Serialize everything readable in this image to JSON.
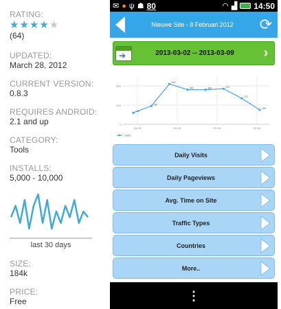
{
  "listing": {
    "rating_label": "RATING:",
    "rating_stars": 4,
    "rating_max": 5,
    "rating_count": "(64)",
    "updated_label": "UPDATED:",
    "updated_value": "March 28, 2012",
    "version_label": "CURRENT VERSION:",
    "version_value": "0.8.3",
    "requires_label": "REQUIRES ANDROID:",
    "requires_value": "2.1 and up",
    "category_label": "CATEGORY:",
    "category_value": "Tools",
    "installs_label": "INSTALLS:",
    "installs_value": "5,000 - 10,000",
    "sparkline_caption": "last 30 days",
    "sparkline_values": [
      5,
      7,
      4,
      8,
      3,
      7,
      9,
      4,
      8,
      3,
      6,
      4,
      7,
      5,
      8,
      4,
      6,
      5
    ],
    "size_label": "SIZE:",
    "size_value": "184k",
    "price_label": "PRICE:",
    "price_value": "Free",
    "colors": {
      "accent": "#3fa9d8",
      "star_off": "#c9c9c9"
    }
  },
  "statusbar": {
    "icons": [
      "mail-icon",
      "circle-icon",
      "usb-icon",
      "android-icon"
    ],
    "temperature": "80",
    "time": "14:50"
  },
  "app": {
    "title": "Nieuwe Site - 8 Februari 2012",
    "date_range": "2013-03-02 -- 2013-03-09",
    "colors": {
      "titlebar": "#35a6e8",
      "daterange": "#67c135",
      "button": "#a9d6f6"
    }
  },
  "chart_data": {
    "type": "line",
    "y_ticks": [
      "400",
      "200",
      "0"
    ],
    "x_ticks": [
      "03-03",
      "03-04",
      "03-05",
      "03-06"
    ],
    "values": [
      120,
      190,
      420,
      360,
      360,
      370,
      270,
      150
    ],
    "point_labels": [
      "120",
      "190",
      "420",
      "360",
      "360",
      "370",
      "270",
      "150"
    ],
    "ylim": [
      0,
      500
    ],
    "legend": "Visits",
    "legend_position": "bottom-left",
    "grid": true
  },
  "menu": [
    {
      "label": "Daily Visits"
    },
    {
      "label": "Daily Pageviews"
    },
    {
      "label": "Avg. Time on Site"
    },
    {
      "label": "Traffic Types"
    },
    {
      "label": "Countries"
    },
    {
      "label": "More.."
    }
  ],
  "navbar": {
    "overflow": "⋮"
  }
}
